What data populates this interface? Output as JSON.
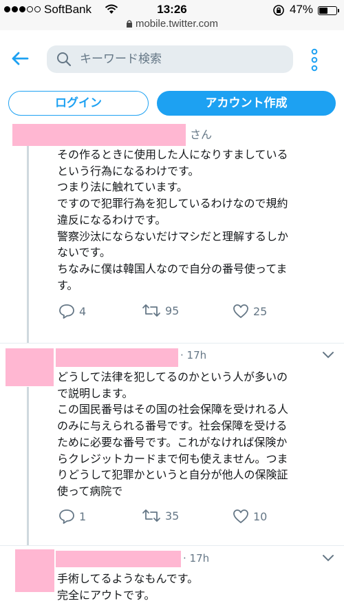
{
  "status_bar": {
    "carrier": "SoftBank",
    "time": "13:26",
    "battery": "47%"
  },
  "browser": {
    "url": "mobile.twitter.com"
  },
  "header": {
    "search_placeholder": "キーワード検索"
  },
  "auth": {
    "login_label": "ログイン",
    "signup_label": "アカウント作成"
  },
  "tweets": [
    {
      "name_suffix": "さん",
      "text": "その作るときに使用した人になりすましている\nという行為になるわけです。\nつまり法に触れています。\nですので犯罪行為を犯しているわけなので規約\n違反になるわけです。\n警察沙汰にならないだけマシだと理解するしか\nないです。\nちなみに僕は韓国人なので自分の番号使ってま\nす。",
      "replies": "4",
      "retweets": "95",
      "likes": "25"
    },
    {
      "time": "17h",
      "text": "どうして法律を犯してるのかという人が多いの\nで説明します。\nこの国民番号はその国の社会保障を受けれる人\nのみに与えられる番号です。社会保障を受ける\nために必要な番号です。これがなければ保険か\nらクレジットカードまで何も使えません。つま\nりどうして犯罪かというと自分が他人の保険証\n使って病院で",
      "replies": "1",
      "retweets": "35",
      "likes": "10"
    },
    {
      "time": "17h",
      "text": "手術してるようなもんです。\n完全にアウトです。"
    }
  ],
  "colors": {
    "accent": "#1da1f2",
    "redaction": "#ffb7d2",
    "muted": "#657786"
  }
}
